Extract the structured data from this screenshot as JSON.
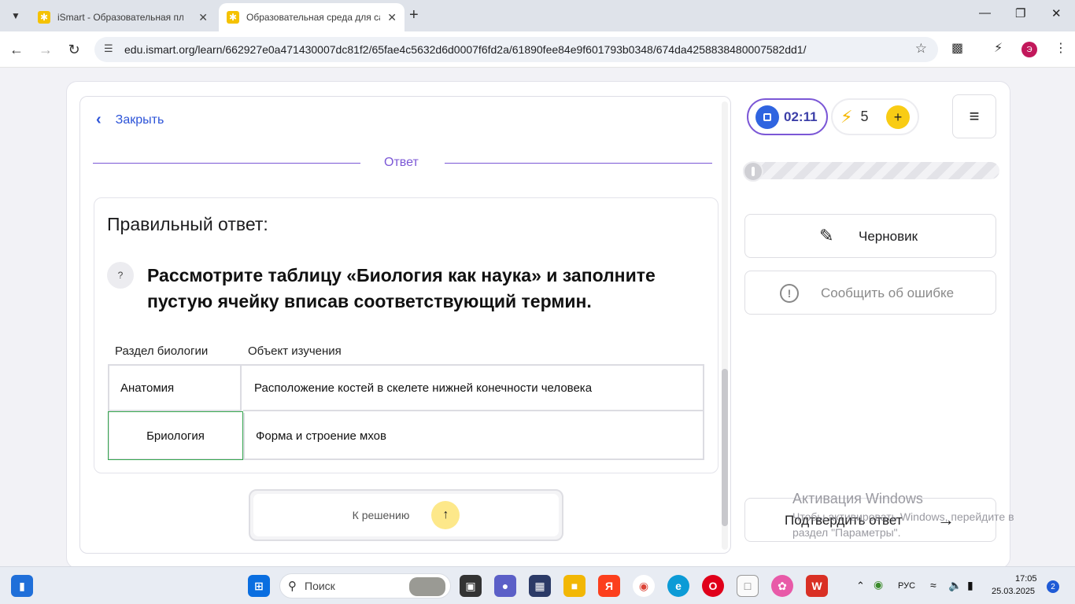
{
  "browser": {
    "tabs": [
      {
        "title": "iSmart - Образовательная пла",
        "active": false
      },
      {
        "title": "Образовательная среда для са",
        "active": true
      }
    ],
    "url": "edu.ismart.org/learn/662927e0a471430007dc81f2/65fae4c5632d6d0007f6fd2a/61890fee84e9f601793b0348/674da4258838480007582dd1/",
    "profile_initial": "Э"
  },
  "card": {
    "close_label": "Закрыть",
    "section_label": "Ответ",
    "answer_title": "Правильный ответ:",
    "question_icon": "?",
    "question_text": "Рассмотрите таблицу «Биология как наука» и заполните пустую ячейку вписав соответствующий термин.",
    "table": {
      "headers": [
        "Раздел биологии",
        "Объект изучения"
      ],
      "rows": [
        [
          "Анатомия",
          "Расположение костей в скелете нижней конечности человека"
        ],
        [
          "Бриология",
          "Форма и строение мхов"
        ]
      ]
    },
    "to_solution_label": "К решению"
  },
  "sidebar": {
    "timer": "02:11",
    "energy_count": "5",
    "progress_fraction": 0,
    "draft_label": "Черновик",
    "report_label": "Сообщить об ошибке",
    "confirm_label": "Подтвердить ответ"
  },
  "watermark": {
    "title": "Активация Windows",
    "subtitle": "Чтобы активировать Windows, перейдите в раздел \"Параметры\"."
  },
  "taskbar": {
    "search_label": "Поиск",
    "language": "РУС",
    "time": "17:05",
    "date": "25.03.2025",
    "notifications": "2"
  },
  "colors": {
    "accent_purple": "#7b57d6",
    "link_blue": "#2d54d8",
    "correct_green": "#36a84f",
    "energy_yellow": "#f9cc14"
  }
}
